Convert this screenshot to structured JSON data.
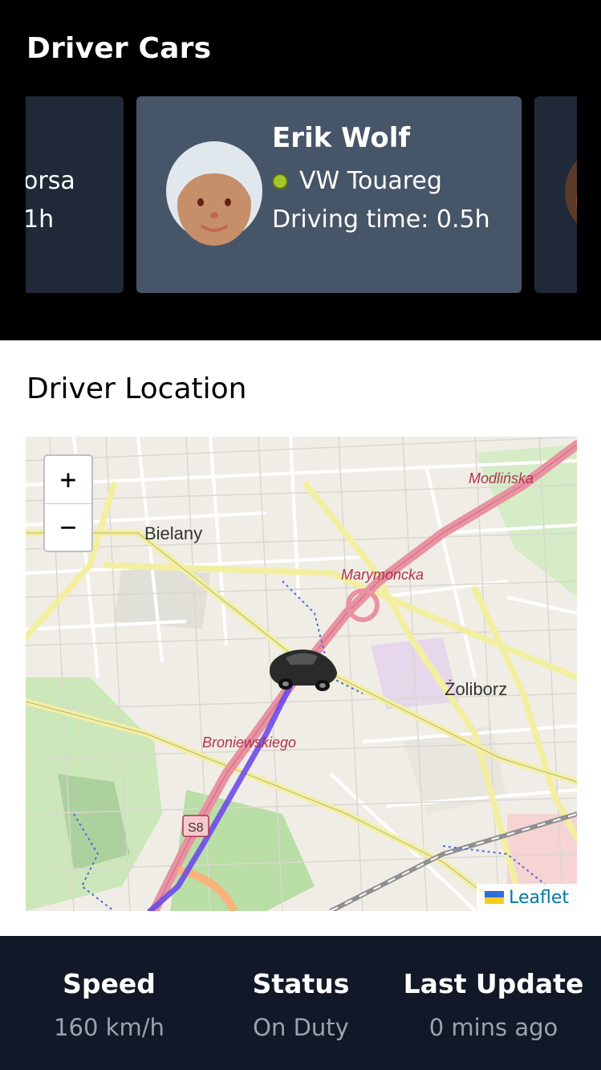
{
  "header": {
    "title": "Driver Cars"
  },
  "carousel": {
    "left_card": {
      "name_fragment": "orsa",
      "time_fragment": "1h"
    },
    "center_card": {
      "name": "Erik Wolf",
      "car": "VW Touareg",
      "status_color": "#a3c72c",
      "driving_time": "Driving time: 0.5h"
    }
  },
  "location": {
    "title": "Driver Location",
    "zoom_in": "+",
    "zoom_out": "−",
    "attribution": "Leaflet",
    "labels": {
      "bielany": "Bielany",
      "marymoncka": "Marymoncka",
      "modlinska": "Modlińska",
      "zoliborz": "Żoliborz",
      "broniewskiego": "Broniewskiego",
      "s8": "S8"
    }
  },
  "stats": {
    "speed_label": "Speed",
    "speed_value": "160 km/h",
    "status_label": "Status",
    "status_value": "On Duty",
    "update_label": "Last Update",
    "update_value": "0 mins ago"
  }
}
